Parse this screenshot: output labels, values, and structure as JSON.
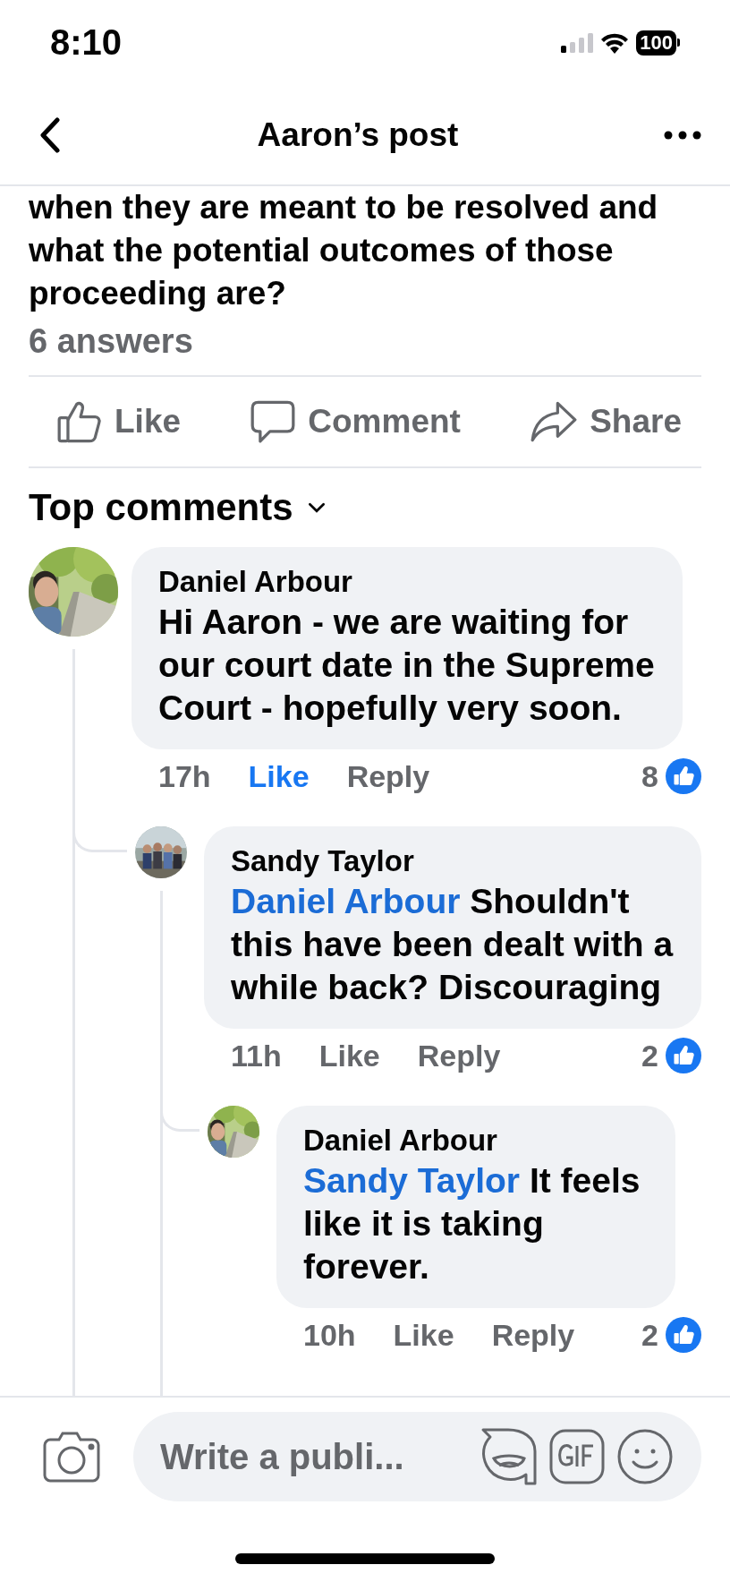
{
  "status_bar": {
    "time": "8:10",
    "battery": "100"
  },
  "nav": {
    "title": "Aaron’s post"
  },
  "post": {
    "text": "when they are meant to be resolved and what the potential outcomes of those proceeding are?",
    "answers": "6 answers"
  },
  "actions": [
    {
      "kind": "like",
      "label": "Like"
    },
    {
      "kind": "comment",
      "label": "Comment"
    },
    {
      "kind": "share",
      "label": "Share"
    }
  ],
  "sort": {
    "label": "Top comments"
  },
  "comments": [
    {
      "author": "Daniel Arbour",
      "text": "Hi Aaron - we are waiting for our court date in the Supreme Court - hopefully very soon.",
      "time": "17h",
      "like": "Like",
      "liked": true,
      "reply": "Reply",
      "reactions": "8",
      "children": [
        {
          "author": "Sandy Taylor",
          "mention": "Daniel Arbour",
          "text": "Shouldn't this have been dealt with a while back? Discouraging",
          "time": "11h",
          "like": "Like",
          "liked": false,
          "reply": "Reply",
          "reactions": "2",
          "children": [
            {
              "author": "Daniel Arbour",
              "mention": "Sandy Taylor",
              "text": "It feels like it is taking forever.",
              "time": "10h",
              "like": "Like",
              "liked": false,
              "reply": "Reply",
              "reactions": "2"
            }
          ]
        }
      ]
    }
  ],
  "composer": {
    "placeholder": "Write a publi..."
  }
}
